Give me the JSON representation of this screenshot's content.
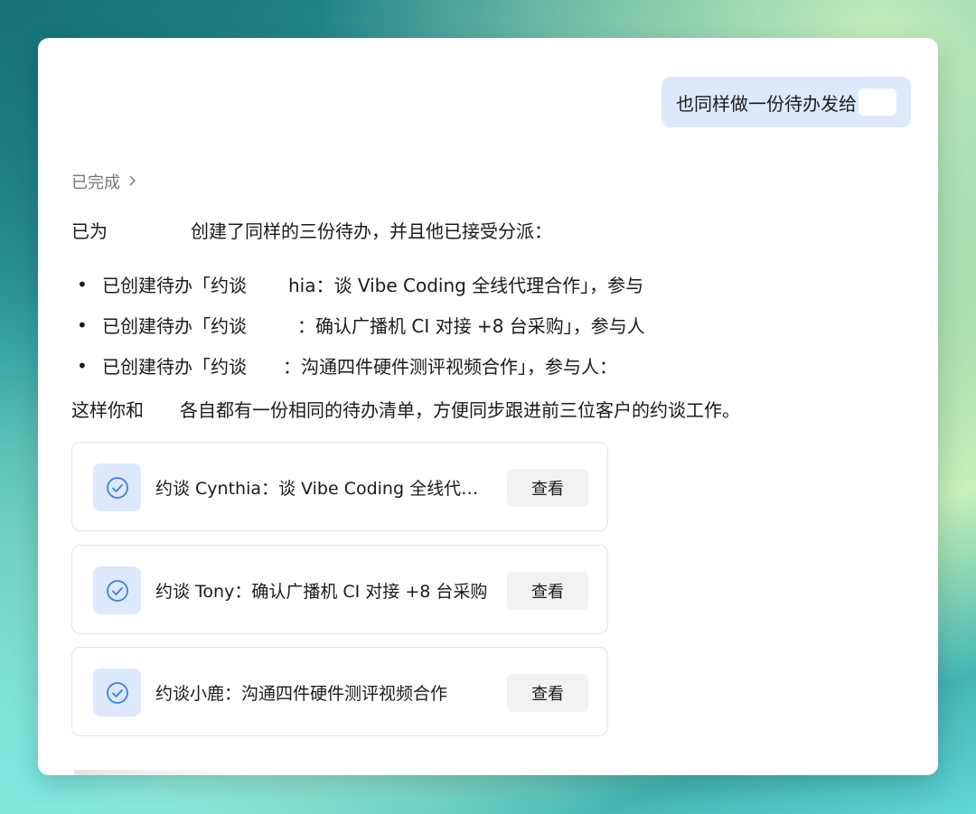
{
  "chat": {
    "user_message": "也同样做一份待办发给",
    "status_label": "已完成",
    "summary": {
      "prefix": "已为",
      "suffix": "创建了同样的三份待办，并且他已接受分派："
    },
    "bullets": [
      {
        "left": "已创建待办「约谈",
        "right": "hia：谈 Vibe Coding 全线代理合作」，参与"
      },
      {
        "left": "已创建待办「约谈",
        "right": "：确认广播机 CI 对接 +8 台采购」，参与人"
      },
      {
        "left": "已创建待办「约谈",
        "right": "：沟通四件硬件测评视频合作」，参与人："
      }
    ],
    "closing": {
      "prefix": "这样你和",
      "suffix": "各自都有一份相同的待办清单，方便同步跟进前三位客户的约谈工作。"
    },
    "todo_cards": [
      {
        "title": "约谈 Cynthia：谈 Vibe Coding 全线代理合作",
        "button": "查看"
      },
      {
        "title": "约谈 Tony：确认广播机 CI 对接 +8 台采购",
        "button": "查看"
      },
      {
        "title": "约谈小鹿：沟通四件硬件测评视频合作",
        "button": "查看"
      }
    ]
  },
  "icons": {
    "status": "chevron-right-icon",
    "card": "check-circle-icon"
  },
  "colors": {
    "user_bubble": "#dde9fb",
    "check_bg": "#dde8fb",
    "check_icon": "#3d7fe0",
    "button_bg": "#f2f2f2"
  }
}
